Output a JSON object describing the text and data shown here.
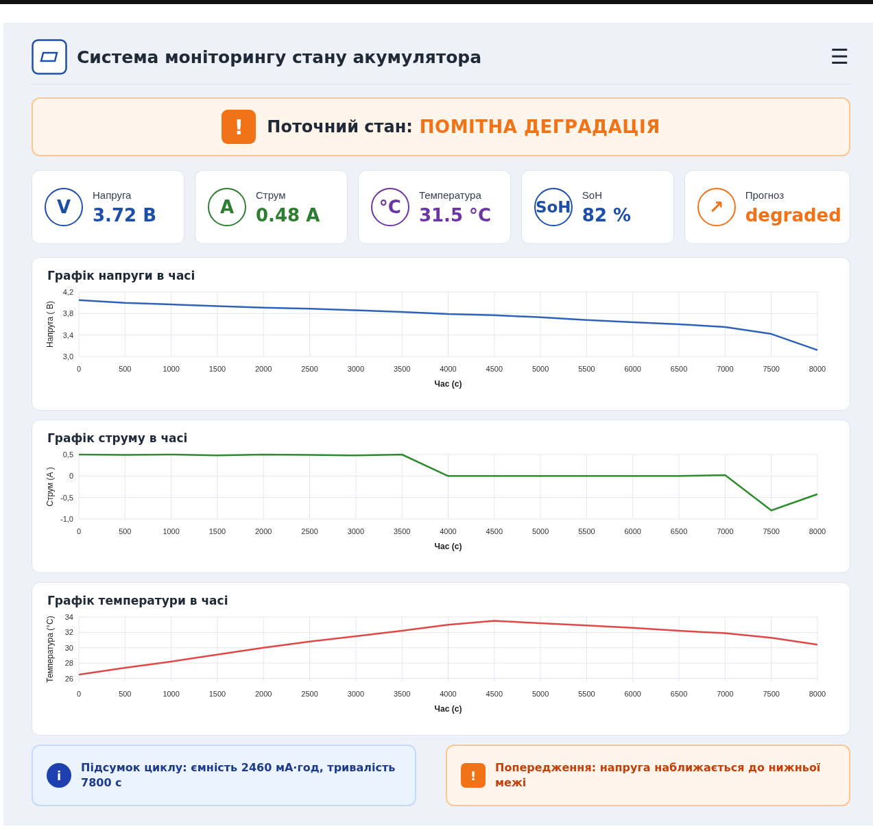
{
  "header": {
    "title": "Система моніторингу стану акумулятора",
    "menu_icon": "☰"
  },
  "status": {
    "icon": "!",
    "label": "Поточний стан:",
    "value": "ПОМІТНА ДЕГРАДАЦІЯ"
  },
  "metrics": [
    {
      "icon": "V",
      "label": "Напруга",
      "value": "3.72 В",
      "color": "#1e4fa8"
    },
    {
      "icon": "A",
      "label": "Струм",
      "value": "0.48 A",
      "color": "#2e7d32"
    },
    {
      "icon": "°C",
      "label": "Температура",
      "value": "31.5 °C",
      "color": "#6b35a5"
    },
    {
      "icon": "SoH",
      "label": "SoH",
      "value": "82 %",
      "color": "#1e4fa8"
    },
    {
      "icon": "↗",
      "label": "Прогноз",
      "value": "degraded",
      "color": "#f07318"
    }
  ],
  "charts": [
    {
      "chart_data": {
        "type": "line",
        "title": "Графік напруги в часі",
        "xlabel": "Час (с)",
        "ylabel": "Напруга ( В)",
        "x": [
          0,
          500,
          1000,
          1500,
          2000,
          2500,
          3000,
          3500,
          4000,
          4500,
          5000,
          5500,
          6000,
          6500,
          7000,
          7500,
          8000
        ],
        "series": [
          {
            "color": "#2e62b8",
            "values": [
              4.05,
              4.0,
              3.97,
              3.94,
              3.91,
              3.89,
              3.86,
              3.83,
              3.79,
              3.77,
              3.73,
              3.68,
              3.64,
              3.6,
              3.55,
              3.42,
              3.12
            ]
          }
        ],
        "xlim": [
          0,
          8000
        ],
        "ylim": [
          3.0,
          4.2
        ],
        "grid": true,
        "xticks": [
          0,
          500,
          1000,
          1500,
          2000,
          2500,
          3000,
          3500,
          4000,
          4500,
          5000,
          5500,
          6000,
          6500,
          7000,
          7500,
          8000
        ],
        "yticks": [
          {
            "value": 3.0,
            "label": "3,0"
          },
          {
            "value": 3.4,
            "label": "3,4"
          },
          {
            "value": 3.8,
            "label": "3,8"
          },
          {
            "value": 4.2,
            "label": "4,2"
          }
        ]
      }
    },
    {
      "chart_data": {
        "type": "line",
        "title": "Графік струму в часі",
        "xlabel": "Час (с)",
        "ylabel": "Струм (А )",
        "x": [
          0,
          500,
          1000,
          1500,
          2000,
          2500,
          3000,
          3500,
          4000,
          4500,
          5000,
          5500,
          6000,
          6500,
          7000,
          7500,
          8000
        ],
        "series": [
          {
            "color": "#2e8b2e",
            "values": [
              0.5,
              0.49,
              0.5,
              0.48,
              0.5,
              0.49,
              0.48,
              0.5,
              0.0,
              0.0,
              0.0,
              0.0,
              0.0,
              0.0,
              0.02,
              -0.8,
              -0.42
            ]
          }
        ],
        "xlim": [
          0,
          8000
        ],
        "ylim": [
          -1.0,
          0.5
        ],
        "grid": true,
        "xticks": [
          0,
          500,
          1000,
          1500,
          2000,
          2500,
          3000,
          3500,
          4000,
          4500,
          5000,
          5500,
          6000,
          6500,
          7000,
          7500,
          8000
        ],
        "yticks": [
          {
            "value": -1.0,
            "label": "-1,0"
          },
          {
            "value": -0.5,
            "label": "-0,5"
          },
          {
            "value": 0,
            "label": "0"
          },
          {
            "value": 0.5,
            "label": "0,5"
          }
        ]
      }
    },
    {
      "chart_data": {
        "type": "line",
        "title": "Графік температури в часі",
        "xlabel": "Час (с)",
        "ylabel": "Температура (°С)",
        "x": [
          0,
          500,
          1000,
          1500,
          2000,
          2500,
          3000,
          3500,
          4000,
          4500,
          5000,
          5500,
          6000,
          6500,
          7000,
          7500,
          8000
        ],
        "series": [
          {
            "color": "#e04848",
            "values": [
              26.5,
              27.4,
              28.2,
              29.1,
              30.0,
              30.8,
              31.5,
              32.2,
              33.0,
              33.5,
              33.2,
              32.9,
              32.6,
              32.2,
              31.9,
              31.3,
              30.4
            ]
          }
        ],
        "xlim": [
          0,
          8000
        ],
        "ylim": [
          25.6,
          34
        ],
        "grid": true,
        "xticks": [
          0,
          500,
          1000,
          1500,
          2000,
          2500,
          3000,
          3500,
          4000,
          4500,
          5000,
          5500,
          6000,
          6500,
          7000,
          7500,
          8000
        ],
        "yticks": [
          26,
          28,
          30,
          32,
          34
        ]
      }
    }
  ],
  "alerts": [
    {
      "kind": "info",
      "icon": "i",
      "text": "Підсумок циклу: ємність 2460 мА·год, тривалість 7800 с"
    },
    {
      "kind": "warning",
      "icon": "!",
      "text": "Попередження: напруга наближається до нижньої межі"
    }
  ]
}
